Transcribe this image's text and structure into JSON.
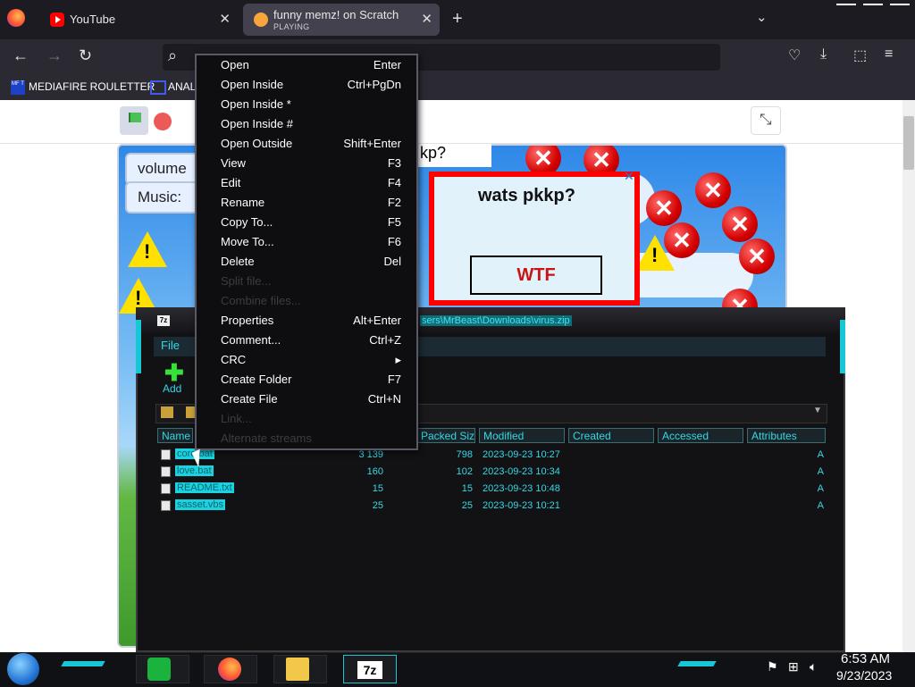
{
  "browser": {
    "tabs": [
      {
        "title": "YouTube",
        "close": "✕"
      },
      {
        "title": "funny memz! on Scratch",
        "subtitle": "PLAYING",
        "close": "✕"
      }
    ],
    "new_tab": "+",
    "list_all_tabs": "⌄",
    "nav": {
      "back": "←",
      "forward": "→",
      "reload": "↻",
      "search_icon": "⌕"
    },
    "toolbar_icons": [
      "pocket-icon",
      "download-icon",
      "extensions-icon",
      "menu-icon"
    ],
    "bookmarks": [
      {
        "icon_text": "MF T",
        "label": "MEDIAFIRE ROULETTER"
      },
      {
        "label": "ANAL"
      }
    ]
  },
  "scratch": {
    "green_flag": "green-flag-icon",
    "stop": "stop-icon",
    "fullscreen": "fullscreen-icon",
    "stage": {
      "volume_label": "volume",
      "music_label": "Music: ",
      "pkkp_text": "kp?",
      "popup": {
        "title": "wats pkkp?",
        "button": "WTF",
        "close": "✕"
      }
    }
  },
  "sevenzip": {
    "title_icon": "7z",
    "path": "sers\\MrBeast\\Downloads\\virus.zip",
    "menu": [
      "File"
    ],
    "toolbar": {
      "add_label": "Add",
      "add_icon": "✚"
    },
    "columns": [
      "Name",
      "Packed Size",
      "Modified",
      "Created",
      "Accessed",
      "Attributes"
    ],
    "rows": [
      {
        "name": "core.bat",
        "size": "3 139",
        "packed": "798",
        "modified": "2023-09-23 10:27",
        "attr": "A"
      },
      {
        "name": "love.bat",
        "size": "160",
        "packed": "102",
        "modified": "2023-09-23 10:34",
        "attr": "A"
      },
      {
        "name": "README.txt",
        "size": "15",
        "packed": "15",
        "modified": "2023-09-23 10:48",
        "attr": "A"
      },
      {
        "name": "sasset.vbs",
        "size": "25",
        "packed": "25",
        "modified": "2023-09-23 10:21",
        "attr": "A"
      }
    ]
  },
  "context_menu": [
    {
      "label": "Open",
      "shortcut": "Enter",
      "disabled": false
    },
    {
      "label": "Open Inside",
      "shortcut": "Ctrl+PgDn",
      "disabled": false
    },
    {
      "label": "Open Inside *",
      "shortcut": "",
      "disabled": false
    },
    {
      "label": "Open Inside #",
      "shortcut": "",
      "disabled": false
    },
    {
      "label": "Open Outside",
      "shortcut": "Shift+Enter",
      "disabled": false
    },
    {
      "label": "View",
      "shortcut": "F3",
      "disabled": false
    },
    {
      "label": "Edit",
      "shortcut": "F4",
      "disabled": false
    },
    {
      "label": "Rename",
      "shortcut": "F2",
      "disabled": false
    },
    {
      "label": "Copy To...",
      "shortcut": "F5",
      "disabled": false
    },
    {
      "label": "Move To...",
      "shortcut": "F6",
      "disabled": false
    },
    {
      "label": "Delete",
      "shortcut": "Del",
      "disabled": false
    },
    {
      "label": "Split file...",
      "shortcut": "",
      "disabled": true
    },
    {
      "label": "Combine files...",
      "shortcut": "",
      "disabled": true
    },
    {
      "label": "Properties",
      "shortcut": "Alt+Enter",
      "disabled": false
    },
    {
      "label": "Comment...",
      "shortcut": "Ctrl+Z",
      "disabled": false
    },
    {
      "label": "CRC",
      "shortcut": "▸",
      "disabled": false
    },
    {
      "label": "Create Folder",
      "shortcut": "F7",
      "disabled": false
    },
    {
      "label": "Create File",
      "shortcut": "Ctrl+N",
      "disabled": false
    },
    {
      "label": "Link...",
      "shortcut": "",
      "disabled": true
    },
    {
      "label": "Alternate streams",
      "shortcut": "",
      "disabled": true
    }
  ],
  "taskbar": {
    "apps": [
      "notes-icon",
      "firefox-icon",
      "file-explorer-icon",
      "7zip-icon"
    ],
    "sz7_label": "7z",
    "tray_icons": [
      "flag-icon",
      "network-icon",
      "volume-icon"
    ],
    "time": "6:53 AM",
    "date": "9/23/2023"
  }
}
